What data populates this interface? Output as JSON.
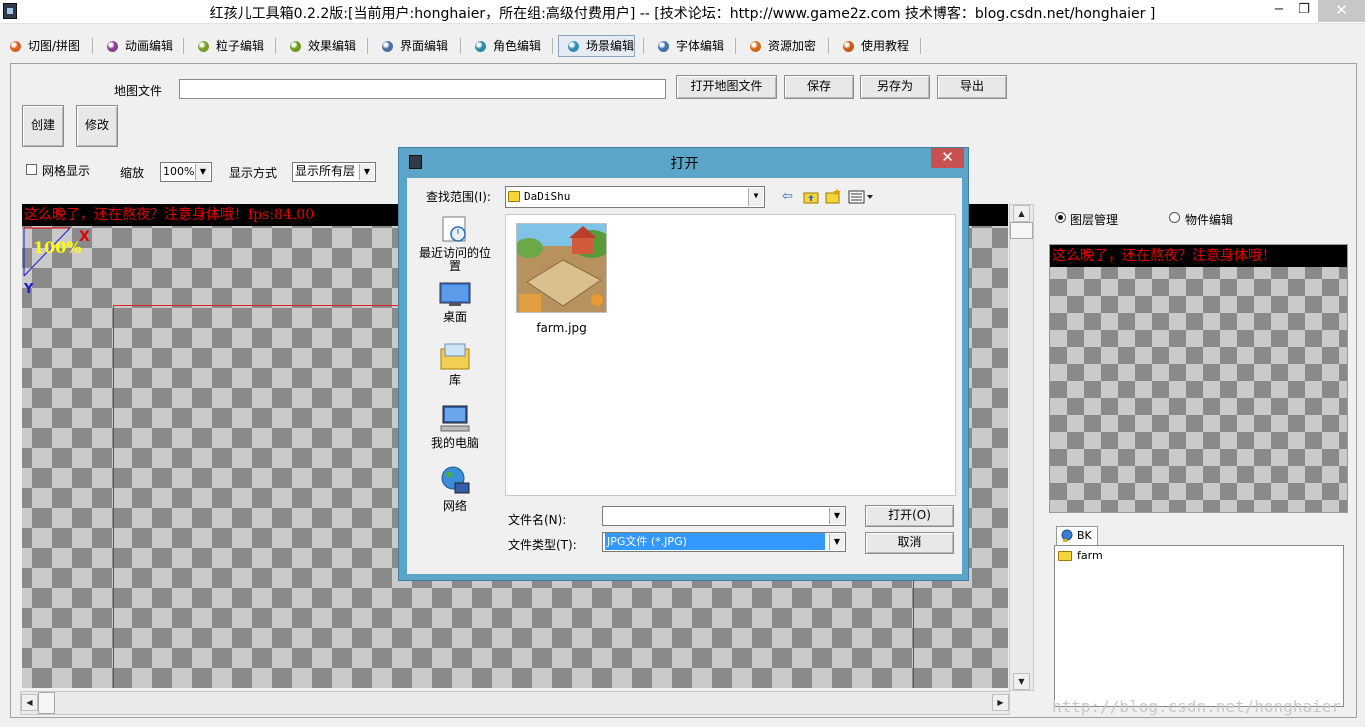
{
  "window": {
    "title": "红孩儿工具箱0.2.2版:[当前用户:honghaier，所在组:高级付费用户]  --  [技术论坛：http://www.game2z.com 技术博客：blog.csdn.net/honghaier ]",
    "minimize": "−",
    "maximize": "❐",
    "close": "✕"
  },
  "tabs": [
    {
      "label": "切图/拼图",
      "color": "#d4621b"
    },
    {
      "label": "动画编辑",
      "color": "#8a3c8f"
    },
    {
      "label": "粒子编辑",
      "color": "#7a9a2a"
    },
    {
      "label": "效果编辑",
      "color": "#6a9a1c"
    },
    {
      "label": "界面编辑",
      "color": "#4a6fa0"
    },
    {
      "label": "角色编辑",
      "color": "#2f88a8"
    },
    {
      "label": "场景编辑",
      "color": "#2f8fb8"
    },
    {
      "label": "字体编辑",
      "color": "#3f6fb0"
    },
    {
      "label": "资源加密",
      "color": "#d06a12"
    },
    {
      "label": "使用教程",
      "color": "#c85a14"
    }
  ],
  "active_tab": "场景编辑",
  "map_file": {
    "label": "地图文件",
    "value": "",
    "open_button": "打开地图文件",
    "save_button": "保存",
    "save_as_button": "另存为",
    "export_button": "导出"
  },
  "mode_buttons": {
    "create": "创建",
    "modify": "修改"
  },
  "options": {
    "grid_label": "网格显示",
    "grid_checked": false,
    "zoom_label": "缩放",
    "zoom_value": "100%",
    "display_label": "显示方式",
    "display_value": "显示所有层"
  },
  "canvas": {
    "message": "这么晚了，还在熬夜？注意身体哦！fps:84.00",
    "zoom_overlay": "100%",
    "axis_x": "X",
    "axis_y": "Y"
  },
  "right_panel": {
    "layer_radio": "图层管理",
    "object_radio": "物件编辑",
    "layer_selected": true,
    "preview_message": "这么晚了，还在熬夜？注意身体哦！",
    "tree_tab": "BK",
    "tree_items": [
      "farm"
    ]
  },
  "watermark": "http://blog.csdn.net/honghaier",
  "dialog": {
    "title": "打开",
    "close": "✕",
    "look_in_label": "查找范围(I):",
    "look_in_value": "DaDiShu",
    "places": [
      "最近访问的位置",
      "桌面",
      "库",
      "我的电脑",
      "网络"
    ],
    "files": [
      {
        "name": "farm.jpg"
      }
    ],
    "filename_label": "文件名(N):",
    "filename_value": "",
    "filetype_label": "文件类型(T):",
    "filetype_value": "JPG文件 (*.JPG)",
    "open_button": "打开(O)",
    "cancel_button": "取消"
  },
  "scroll_arrows": {
    "up": "▲",
    "down": "▼",
    "left": "◀",
    "right": "▶",
    "combo": "▼"
  }
}
